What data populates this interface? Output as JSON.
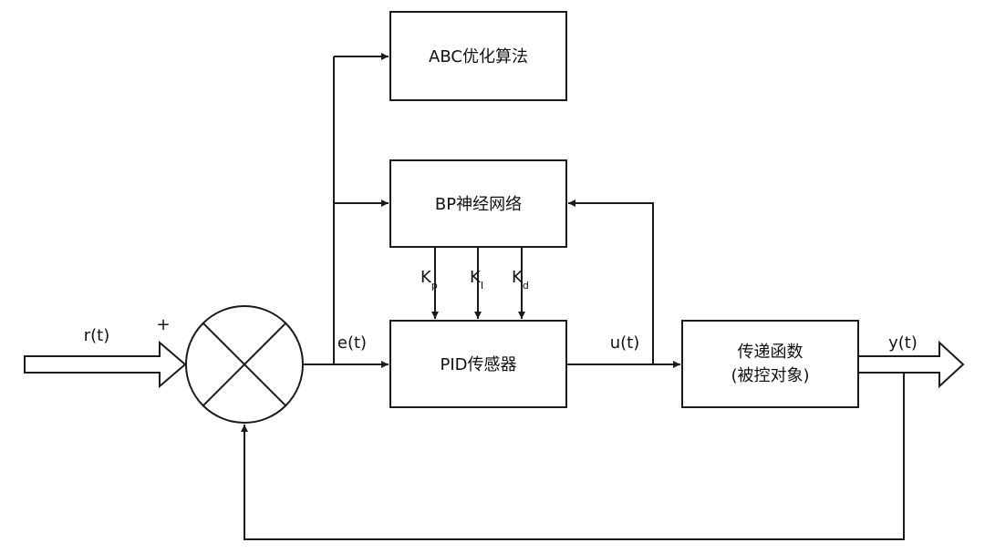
{
  "blocks": {
    "abc": "ABC优化算法",
    "bp": "BP神经网络",
    "pid": "PID传感器",
    "plant_line1": "传递函数",
    "plant_line2": "(被控对象)"
  },
  "signals": {
    "reference": "r(t)",
    "plus_sign": "+",
    "error": "e(t)",
    "control": "u(t)",
    "output": "y(t)"
  },
  "gains": {
    "kp_main": "K",
    "kp_sub": "p",
    "ki_main": "K",
    "ki_sub": "I",
    "kd_main": "K",
    "kd_sub": "d"
  }
}
